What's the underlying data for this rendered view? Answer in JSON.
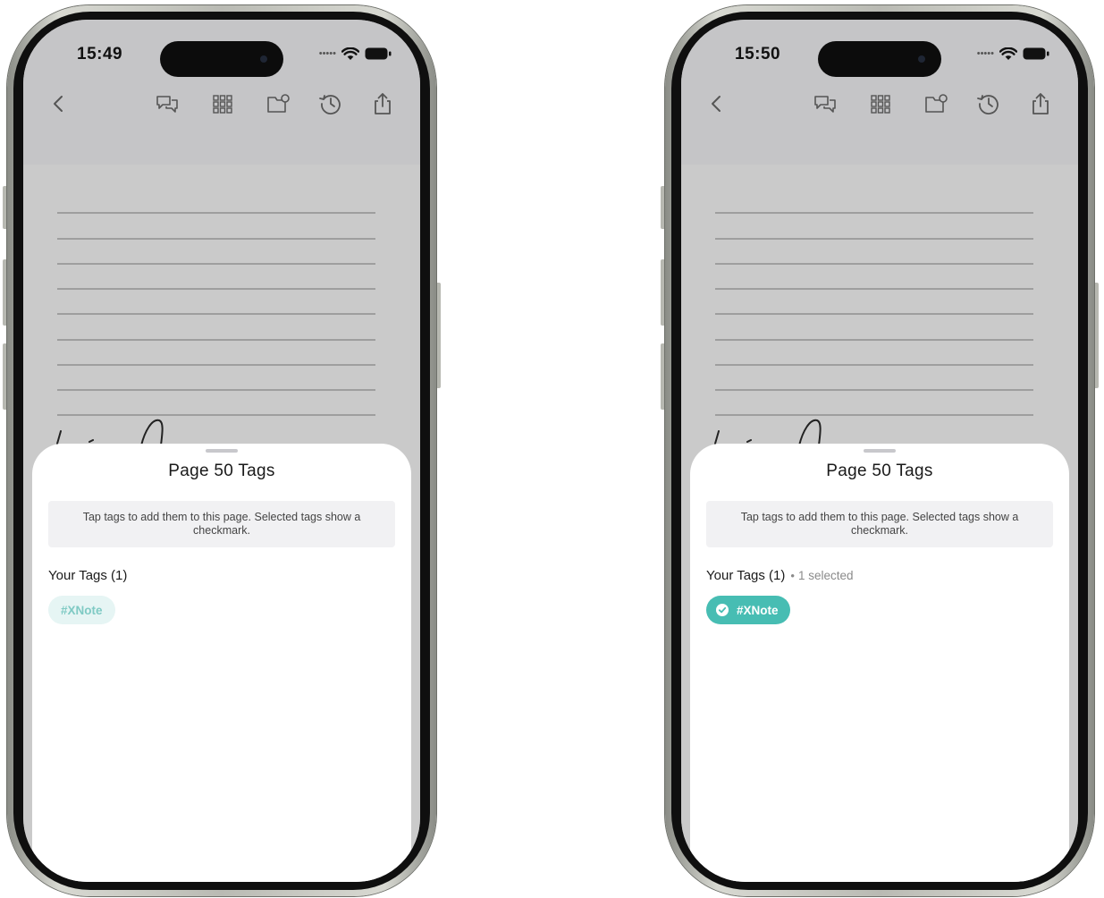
{
  "screens": [
    {
      "status_time": "15:49",
      "sheet": {
        "title": "Page 50 Tags",
        "hint": "Tap tags to add them to this page. Selected tags show a checkmark.",
        "tags_heading": "Your Tags (1)",
        "selection_note": "",
        "tags": [
          {
            "label": "#XNote",
            "selected": false
          }
        ]
      }
    },
    {
      "status_time": "15:50",
      "sheet": {
        "title": "Page 50 Tags",
        "hint": "Tap tags to add them to this page. Selected tags show a checkmark.",
        "tags_heading": "Your Tags (1)",
        "selection_note": "1 selected",
        "tags": [
          {
            "label": "#XNote",
            "selected": true
          }
        ]
      }
    }
  ],
  "toolbar_icons": [
    "back-chevron-icon",
    "comments-icon",
    "page-grid-icon",
    "folder-tag-icon",
    "history-icon",
    "share-icon"
  ],
  "status_icons": [
    "signal-dots-icon",
    "wifi-icon",
    "battery-icon"
  ],
  "colors": {
    "tag_accent": "#47bdb3",
    "tag_unselected_bg": "#e6f5f4",
    "tag_unselected_text": "#7fcac4"
  }
}
